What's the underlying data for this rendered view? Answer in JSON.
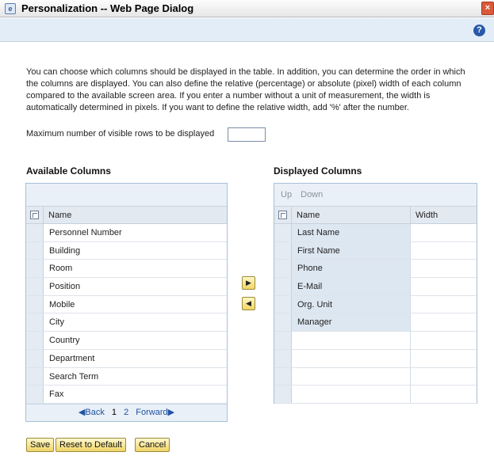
{
  "window": {
    "title": "Personalization -- Web Page Dialog",
    "close_glyph": "×",
    "help_glyph": "?"
  },
  "description": "You can choose which columns should be displayed in the table. In addition, you can determine the order in which the columns are displayed. You can also define the relative (percentage) or absolute (pixel) width of each column compared to the available screen area. If you enter a number without a unit of measurement, the width is automatically determined in pixels. If you want to define the relative width, add '%' after the number.",
  "max_rows": {
    "label": "Maximum number of visible rows to be displayed",
    "value": ""
  },
  "available": {
    "title": "Available Columns",
    "header": "Name",
    "rows": [
      "Personnel Number",
      "Building",
      "Room",
      "Position",
      "Mobile",
      "City",
      "Country",
      "Department",
      "Search Term",
      "Fax"
    ],
    "pager": {
      "back": "◀Back",
      "page1": "1",
      "page2": "2",
      "forward": "Forward▶"
    }
  },
  "displayed": {
    "title": "Displayed Columns",
    "toolbar": {
      "up": "Up",
      "down": "Down"
    },
    "header_name": "Name",
    "header_width": "Width",
    "rows": [
      "Last Name",
      "First Name",
      "Phone",
      "E-Mail",
      "Org. Unit",
      "Manager",
      "",
      "",
      "",
      ""
    ]
  },
  "move_buttons": {
    "right": "▶",
    "left": "◀"
  },
  "buttons": {
    "save": "Save",
    "reset": "Reset to Default",
    "cancel": "Cancel"
  },
  "colors": {
    "accent": "#2859a8",
    "button_fill": "#f2d566",
    "table_border": "#a9bfd6"
  }
}
